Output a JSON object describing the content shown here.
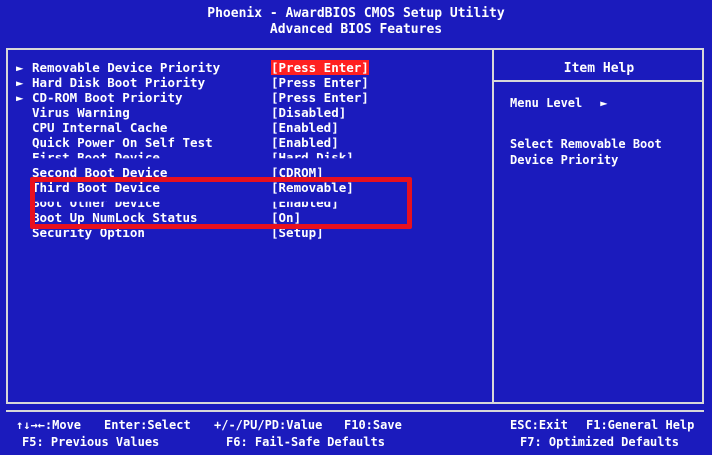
{
  "window": {
    "title_line1": "Phoenix - AwardBIOS CMOS Setup Utility",
    "title_line2": "Advanced BIOS Features"
  },
  "items": [
    {
      "label": "Removable Device Priority",
      "value": "[Press Enter]",
      "submenu": true,
      "selected": true
    },
    {
      "label": "Hard Disk Boot Priority",
      "value": "[Press Enter]",
      "submenu": true,
      "selected": false
    },
    {
      "label": "CD-ROM Boot Priority",
      "value": "[Press Enter]",
      "submenu": true,
      "selected": false
    },
    {
      "label": "Virus Warning",
      "value": "[Disabled]",
      "submenu": false,
      "selected": false
    },
    {
      "label": "CPU Internal Cache",
      "value": "[Enabled]",
      "submenu": false,
      "selected": false
    },
    {
      "label": "Quick Power On Self Test",
      "value": "[Enabled]",
      "submenu": false,
      "selected": false
    },
    {
      "label": "First Boot Device",
      "value": "[Hard Disk]",
      "submenu": false,
      "selected": false
    },
    {
      "label": "Second Boot Device",
      "value": "[CDROM]",
      "submenu": false,
      "selected": false
    },
    {
      "label": "Third Boot Device",
      "value": "[Removable]",
      "submenu": false,
      "selected": false
    },
    {
      "label": "Boot Other Device",
      "value": "[Enabled]",
      "submenu": false,
      "selected": false
    },
    {
      "label": "Boot Up NumLock Status",
      "value": "[On]",
      "submenu": false,
      "selected": false
    },
    {
      "label": "Security Option",
      "value": "[Setup]",
      "submenu": false,
      "selected": false
    }
  ],
  "help": {
    "title": "Item Help",
    "menu_level_label": "Menu Level",
    "menu_level_arrow": "►",
    "description": "Select Removable Boot Device Priority"
  },
  "footer": {
    "move": "↑↓→←:Move",
    "enter": "Enter:Select",
    "value": "+/-/PU/PD:Value",
    "save": "F10:Save",
    "exit": "ESC:Exit",
    "help": "F1:General Help",
    "f5": "F5: Previous Values",
    "f6": "F6: Fail-Safe Defaults",
    "f7": "F7: Optimized Defaults"
  },
  "colors": {
    "background": "#1b1bbd",
    "selection": "#ff2020",
    "annotation_box": "#e8101e",
    "frame": "#d8d8d8"
  },
  "icons": {
    "submenu": "triangle-right-icon"
  }
}
